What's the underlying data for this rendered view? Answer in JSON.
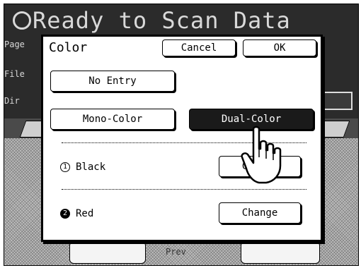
{
  "background": {
    "title": "Ready to Scan Data",
    "page_label": "Page",
    "file_label": "File",
    "dir_label": "Dir",
    "bottom_text": "Prev"
  },
  "dialog": {
    "title": "Color",
    "cancel_label": "Cancel",
    "ok_label": "OK",
    "no_entry_label": "No Entry",
    "mono_color_label": "Mono-Color",
    "dual_color_label": "Dual-Color",
    "selected_mode": "Dual-Color",
    "colors": [
      {
        "number": "1",
        "name": "Black",
        "change_label": "Change"
      },
      {
        "number": "2",
        "name": "Red",
        "change_label": "Change"
      }
    ]
  },
  "colors": {
    "selected_bg": "#1a1a1a",
    "dialog_bg": "#ffffff",
    "screen_bg": "#2b2b2b"
  },
  "icons": [
    "pointing-hand-icon",
    "circle-icon",
    "number-1-icon",
    "number-2-icon"
  ]
}
